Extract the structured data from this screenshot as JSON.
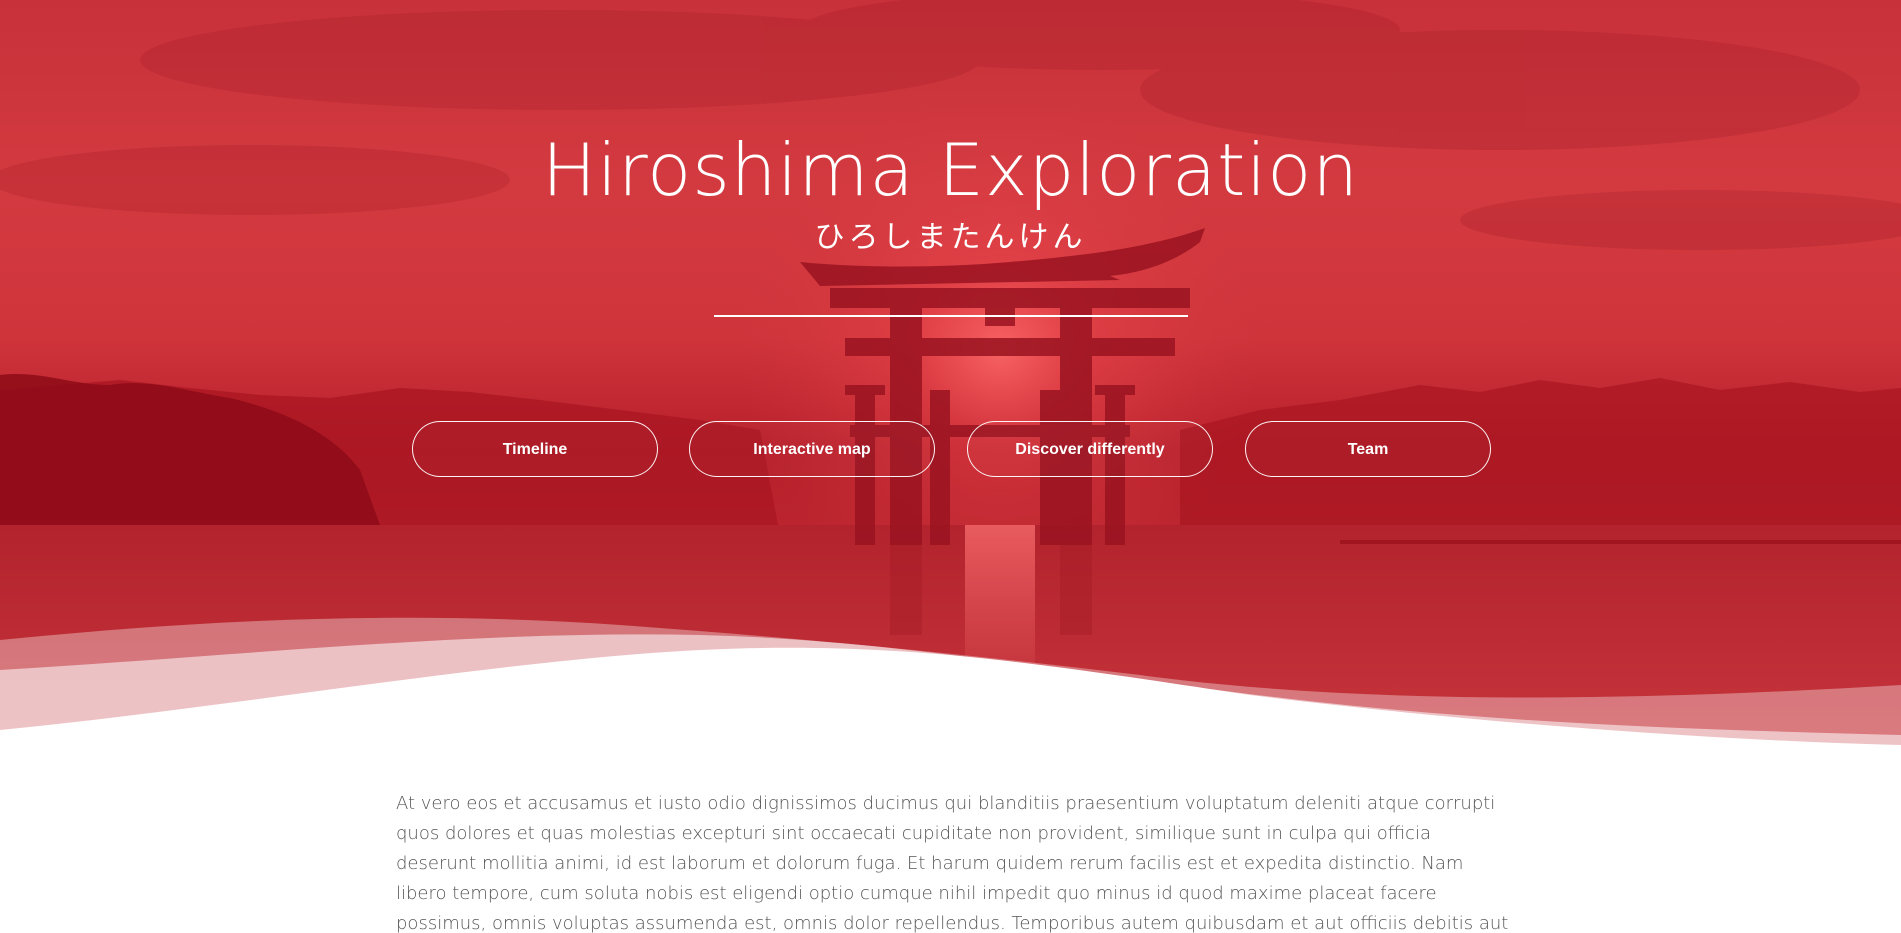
{
  "hero": {
    "title": "Hiroshima Exploration",
    "subtitle": "ひろしまたんけん",
    "nav": [
      {
        "label": "Timeline"
      },
      {
        "label": "Interactive map"
      },
      {
        "label": "Discover differently"
      },
      {
        "label": "Team"
      }
    ]
  },
  "intro": {
    "text": "At vero eos et accusamus et iusto odio dignissimos ducimus qui blanditiis praesentium voluptatum deleniti atque corrupti quos dolores et quas molestias excepturi sint occaecati cupiditate non provident, similique sunt in culpa qui officia deserunt mollitia animi, id est laborum et dolorum fuga. Et harum quidem rerum facilis est et expedita distinctio. Nam libero tempore, cum soluta nobis est eligendi optio cumque nihil impedit quo minus id quod maxime placeat facere possimus, omnis voluptas assumenda est, omnis dolor repellendus. Temporibus autem quibusdam et aut officiis debitis aut rerum necessitatibus saepe eveniet ut et"
  },
  "colors": {
    "hero_red": "#c8313a",
    "text_gray": "#555555",
    "white": "#ffffff"
  },
  "icons": {
    "hero_image": "torii-gate-sunset-image"
  }
}
